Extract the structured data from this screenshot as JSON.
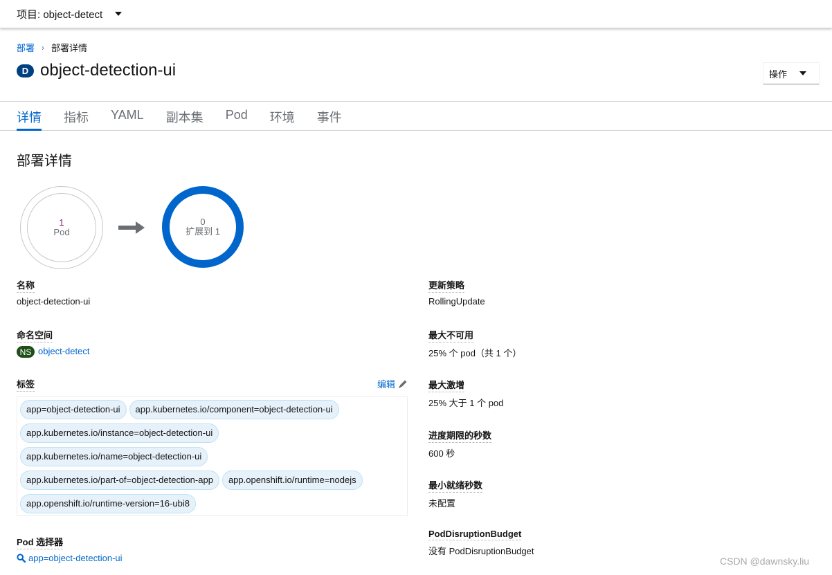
{
  "project_bar": {
    "label": "项目: object-detect"
  },
  "breadcrumb": {
    "parent": "部署",
    "separator": "›",
    "current": "部署详情"
  },
  "header": {
    "resource_badge": "D",
    "title": "object-detection-ui",
    "actions_label": "操作"
  },
  "tabs": [
    {
      "label": "详情",
      "active": true
    },
    {
      "label": "指标",
      "active": false
    },
    {
      "label": "YAML",
      "active": false
    },
    {
      "label": "副本集",
      "active": false
    },
    {
      "label": "Pod",
      "active": false
    },
    {
      "label": "环境",
      "active": false
    },
    {
      "label": "事件",
      "active": false
    }
  ],
  "section_title": "部署详情",
  "pod_status": {
    "current_count": "1",
    "current_label": "Pod",
    "target_count": "0",
    "target_label": "扩展到 1"
  },
  "details_left": {
    "name": {
      "label": "名称",
      "value": "object-detection-ui"
    },
    "namespace": {
      "label": "命名空间",
      "badge": "NS",
      "value": "object-detect"
    },
    "labels": {
      "label": "标签",
      "edit_label": "编辑",
      "items": [
        "app=object-detection-ui",
        "app.kubernetes.io/component=object-detection-ui",
        "app.kubernetes.io/instance=object-detection-ui",
        "app.kubernetes.io/name=object-detection-ui",
        "app.kubernetes.io/part-of=object-detection-app",
        "app.openshift.io/runtime=nodejs",
        "app.openshift.io/runtime-version=16-ubi8"
      ]
    },
    "pod_selector": {
      "label": "Pod 选择器",
      "value": "app=object-detection-ui"
    }
  },
  "details_right": {
    "update_strategy": {
      "label": "更新策略",
      "value": "RollingUpdate"
    },
    "max_unavailable": {
      "label": "最大不可用",
      "value": "25% 个 pod（共 1 个）"
    },
    "max_surge": {
      "label": "最大激增",
      "value": "25% 大于 1 个 pod"
    },
    "progress_deadline": {
      "label": "进度期限的秒数",
      "value": "600 秒"
    },
    "min_ready": {
      "label": "最小就绪秒数",
      "value": "未配置"
    },
    "pdb": {
      "label": "PodDisruptionBudget",
      "value": "没有 PodDisruptionBudget"
    }
  },
  "watermark": "CSDN @dawnsky.liu"
}
